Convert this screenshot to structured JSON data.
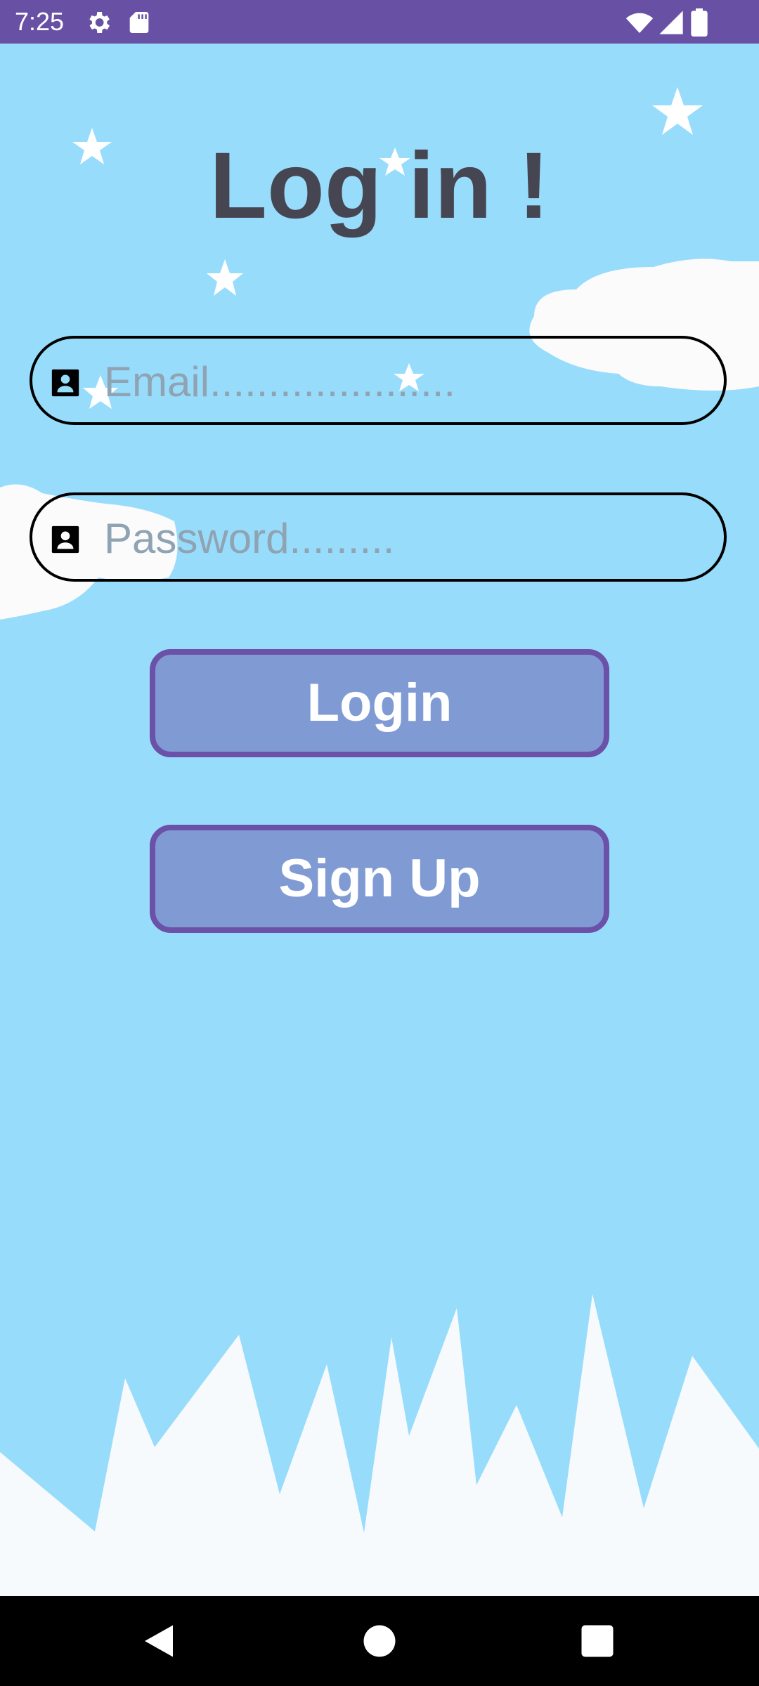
{
  "status_bar": {
    "time": "7:25",
    "left_icons": [
      "gear-icon",
      "sd-card-icon"
    ],
    "right_icons": [
      "wifi-icon",
      "signal-icon",
      "battery-icon"
    ],
    "background": "#6851a5"
  },
  "page": {
    "title": "Log in !",
    "background": "#98dcfc"
  },
  "form": {
    "email": {
      "placeholder": "Email.....................",
      "icon": "contact-card-icon"
    },
    "password": {
      "placeholder": "Password.........",
      "icon": "contact-card-icon"
    }
  },
  "buttons": {
    "login_label": "Login",
    "signup_label": "Sign Up",
    "fill_color": "#809bd4",
    "border_color": "#6b51a8"
  },
  "nav_bar": {
    "icons": [
      "back-icon",
      "home-icon",
      "recents-icon"
    ]
  }
}
